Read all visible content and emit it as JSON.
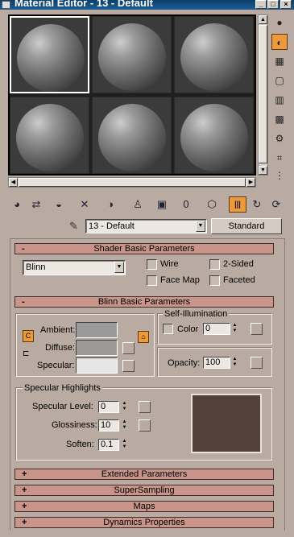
{
  "window": {
    "title": "Material Editor - 13 - Default",
    "controls": [
      "_",
      "□",
      "×"
    ]
  },
  "preview": {
    "slots": 6,
    "selected_slot": 1
  },
  "side_toolbar": {
    "icons": [
      "sample-type-icon",
      "backlight-icon",
      "background-icon",
      "uv-tiling-icon",
      "video-color-check-icon",
      "make-preview-icon",
      "options-icon",
      "select-by-material-icon",
      "material-navigator-icon"
    ],
    "active": "backlight-icon"
  },
  "bottom_toolbar": {
    "icons": [
      "get-material-icon",
      "put-material-icon",
      "assign-material-icon",
      "reset-map-icon",
      "copy-material-icon",
      "make-unique-icon",
      "put-to-library-icon",
      "material-effects-channel-icon",
      "show-map-icon",
      "show-end-result-icon",
      "go-to-parent-icon",
      "go-forward-icon"
    ],
    "active": "show-end-result-icon"
  },
  "material": {
    "name": "13 - Default",
    "type_button": "Standard"
  },
  "shader_basic": {
    "title": "Shader Basic Parameters",
    "toggle": "-",
    "shader": "Blinn",
    "wire": "Wire",
    "two_sided": "2-Sided",
    "face_map": "Face Map",
    "faceted": "Faceted"
  },
  "blinn_basic": {
    "title": "Blinn Basic Parameters",
    "toggle": "-",
    "ambient": "Ambient:",
    "diffuse": "Diffuse:",
    "specular": "Specular:",
    "self_illum_title": "Self-Illumination",
    "color_label": "Color",
    "color_value": "0",
    "opacity_label": "Opacity:",
    "opacity_value": "100",
    "lock_glyph": "C",
    "colors": {
      "ambient": "#9a9a9a",
      "diffuse": "#9a9a9a",
      "specular": "#e6e6e6"
    }
  },
  "specular_highlights": {
    "title": "Specular Highlights",
    "specular_level_label": "Specular Level:",
    "specular_level": "0",
    "glossiness_label": "Glossiness:",
    "glossiness": "10",
    "soften_label": "Soften:",
    "soften": "0.1",
    "curve_color": "#52403a"
  },
  "rollouts": [
    {
      "toggle": "+",
      "title": "Extended Parameters"
    },
    {
      "toggle": "+",
      "title": "SuperSampling"
    },
    {
      "toggle": "+",
      "title": "Maps"
    },
    {
      "toggle": "+",
      "title": "Dynamics Properties"
    }
  ]
}
